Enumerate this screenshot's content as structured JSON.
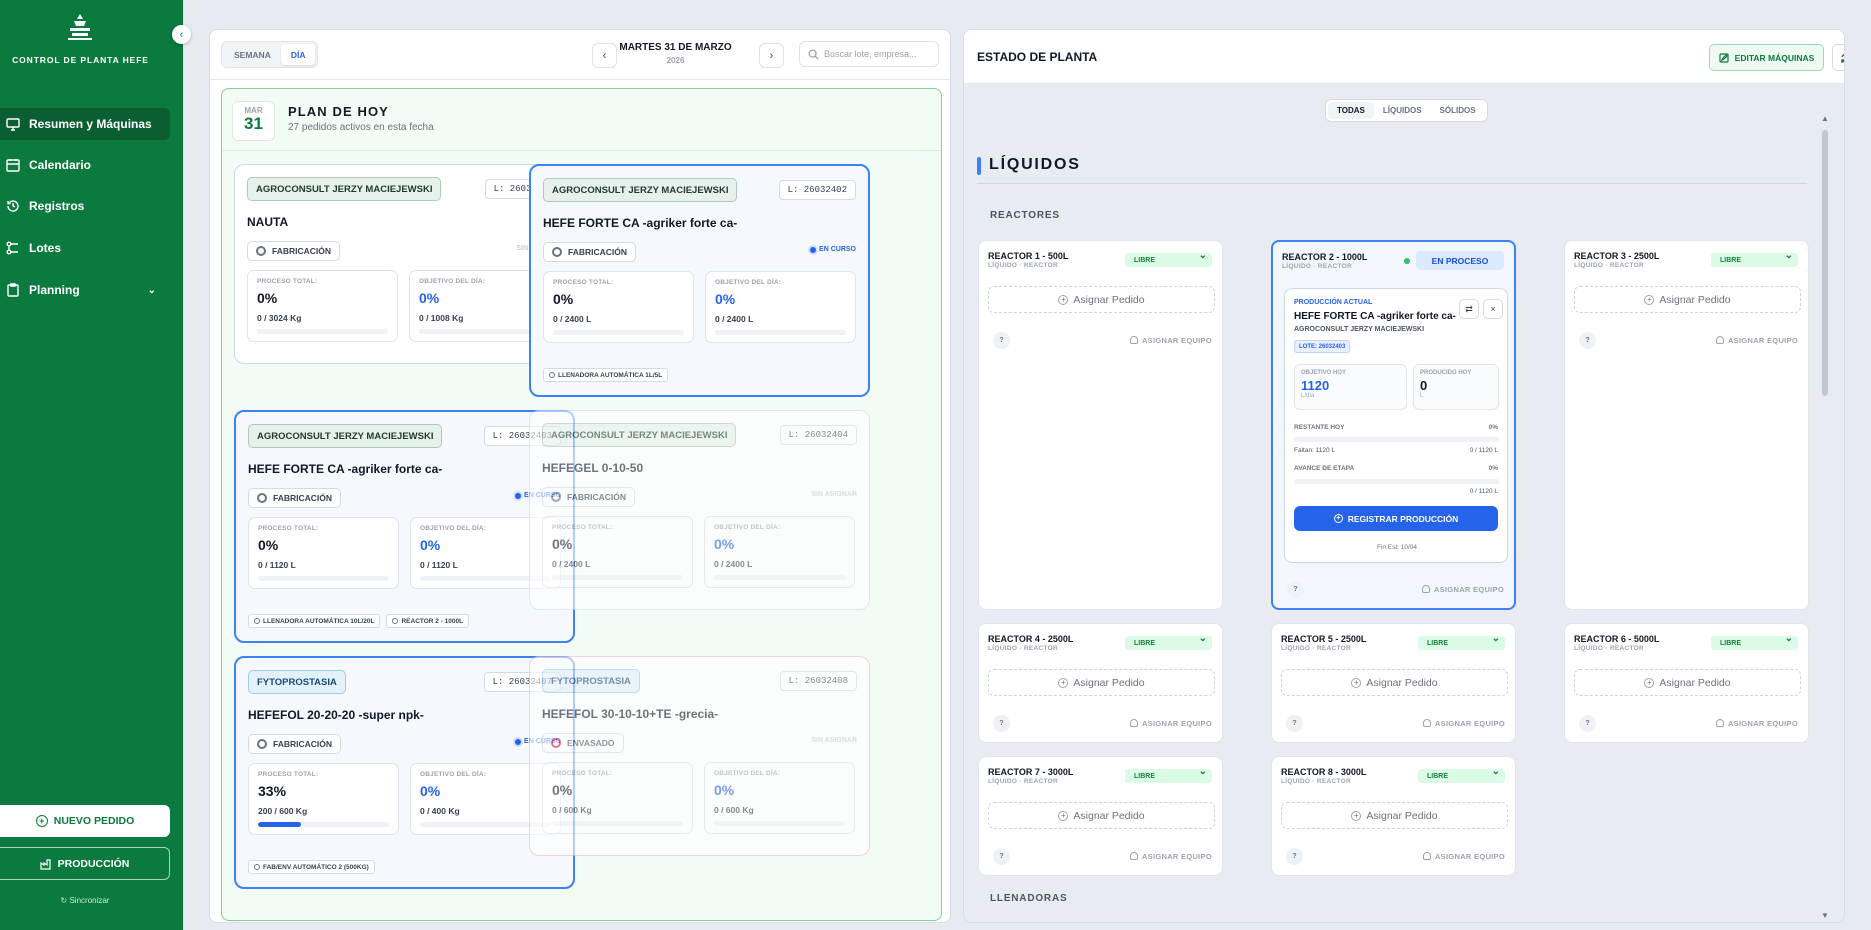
{
  "sidebar": {
    "brand": "CONTROL DE PLANTA HEFE",
    "nav": [
      {
        "label": "Resumen y Máquinas",
        "icon": "monitor-icon"
      },
      {
        "label": "Calendario",
        "icon": "calendar-icon"
      },
      {
        "label": "Registros",
        "icon": "history-icon"
      },
      {
        "label": "Lotes",
        "icon": "layers-icon"
      },
      {
        "label": "Planning",
        "icon": "clipboard-icon"
      }
    ],
    "new_order": "NUEVO PEDIDO",
    "production": "PRODUCCIÓN",
    "sync": "Sincronizar"
  },
  "toolbar": {
    "week": "SEMANA",
    "day": "DÍA",
    "date": "MARTES 31 DE MARZO",
    "year": "2026",
    "search_placeholder": "Buscar lote, empresa..."
  },
  "plan": {
    "month": "MAR",
    "day": "31",
    "title": "PLAN DE HOY",
    "subtitle": "27 pedidos activos en esta fecha",
    "labels": {
      "total": "PROCESO TOTAL:",
      "objective": "OBJETIVO DEL DÍA:"
    },
    "orders": [
      {
        "client": "AGROCONSULT JERZY MACIEJEWSKI",
        "lot": "L: 26032401",
        "product": "NAUTA",
        "stage": "FABRICACIÓN",
        "status": "SIN ASIGNAR",
        "total_pct": "0%",
        "total_qty": "0 / 3024 Kg",
        "obj_pct": "0%",
        "obj_qty": "0 / 1008 Kg",
        "progress": 0,
        "chips": []
      },
      {
        "client": "AGROCONSULT JERZY MACIEJEWSKI",
        "lot": "L: 26032402",
        "product": "HEFE FORTE CA -agriker forte ca-",
        "stage": "FABRICACIÓN",
        "status": "EN CURSO",
        "total_pct": "0%",
        "total_qty": "0 / 2400 L",
        "obj_pct": "0%",
        "obj_qty": "0 / 2400 L",
        "progress": 0,
        "chips": [
          "LLENADORA AUTOMÁTICA 1L/5L"
        ]
      },
      {
        "client": "AGROCONSULT JERZY MACIEJEWSKI",
        "lot": "L: 26032403",
        "product": "HEFE FORTE CA -agriker forte ca-",
        "stage": "FABRICACIÓN",
        "status": "EN CURSO",
        "total_pct": "0%",
        "total_qty": "0 / 1120 L",
        "obj_pct": "0%",
        "obj_qty": "0 / 1120 L",
        "progress": 0,
        "chips": [
          "LLENADORA AUTOMÁTICA 10L/20L",
          "REACTOR 2 - 1000L"
        ]
      },
      {
        "client": "AGROCONSULT JERZY MACIEJEWSKI",
        "lot": "L: 26032404",
        "product": "HEFEGEL 0-10-50",
        "stage": "FABRICACIÓN",
        "status": "SIN ASIGNAR",
        "total_pct": "0%",
        "total_qty": "0 / 2400 L",
        "obj_pct": "0%",
        "obj_qty": "0 / 2400 L",
        "progress": 0,
        "chips": []
      },
      {
        "client": "FYTOPROSTASIA",
        "lot": "L: 26032407",
        "product": "HEFEFOL 20-20-20 -super npk-",
        "stage": "FABRICACIÓN",
        "status": "EN CURSO",
        "total_pct": "33%",
        "total_qty": "200 / 600 Kg",
        "obj_pct": "0%",
        "obj_qty": "0 / 400 Kg",
        "progress": 0.33,
        "chips": [
          "FAB/ENV AUTOMÁTICO 2 (500KG)"
        ]
      },
      {
        "client": "FYTOPROSTASIA",
        "lot": "L: 26032408",
        "product": "HEFEFOL 30-10-10+TE -grecia-",
        "stage": "ENVASADO",
        "status": "SIN ASIGNAR",
        "total_pct": "0%",
        "total_qty": "0 / 600 Kg",
        "obj_pct": "0%",
        "obj_qty": "0 / 600 Kg",
        "progress": 0,
        "chips": []
      }
    ]
  },
  "plant": {
    "title": "ESTADO DE PLANTA",
    "edit": "EDITAR MÁQUINAS",
    "filters": [
      "TODAS",
      "LÍQUIDOS",
      "SÓLIDOS"
    ],
    "section": "LÍQUIDOS",
    "reactors_label": "REACTORES",
    "fillers_label": "LLENADORAS",
    "type": "LÍQUIDO · REACTOR",
    "libre": "LIBRE",
    "assign": "Asignar Pedido",
    "assign_team": "ASIGNAR EQUIPO",
    "qm": "?",
    "reactors": [
      {
        "name": "REACTOR 1 - 500L"
      },
      {
        "name": "REACTOR 2 - 1000L"
      },
      {
        "name": "REACTOR 3 - 2500L"
      },
      {
        "name": "REACTOR 4 - 2500L"
      },
      {
        "name": "REACTOR 5 - 2500L"
      },
      {
        "name": "REACTOR 6 - 5000L"
      },
      {
        "name": "REACTOR 7 - 3000L"
      },
      {
        "name": "REACTOR 8 - 3000L"
      }
    ],
    "active": {
      "status": "EN PROCESO",
      "label": "PRODUCCIÓN ACTUAL",
      "product": "HEFE FORTE CA -agriker forte ca-",
      "client": "AGROCONSULT JERZY MACIEJEWSKI",
      "lot": "LOTE: 26032403",
      "obj_label": "OBJETIVO HOY",
      "obj_value": "1120",
      "obj_unit": "L/día",
      "prod_label": "PRODUCIDO HOY",
      "prod_value": "0",
      "prod_unit": "L",
      "rest_label": "RESTANTE HOY",
      "rest_pct": "0%",
      "faltan": "Faltan: 1120 L",
      "rest_qty": "0 / 1120 L",
      "avance_label": "AVANCE DE ETAPA",
      "avance_pct": "0%",
      "avance_qty": "0 / 1120 L",
      "register": "REGISTRAR PRODUCCIÓN",
      "fin": "Fin Est: 10/04"
    }
  },
  "colors": {
    "sidebar": "#0b7a3e",
    "accent": "#2563eb",
    "ok": "#15803d"
  }
}
